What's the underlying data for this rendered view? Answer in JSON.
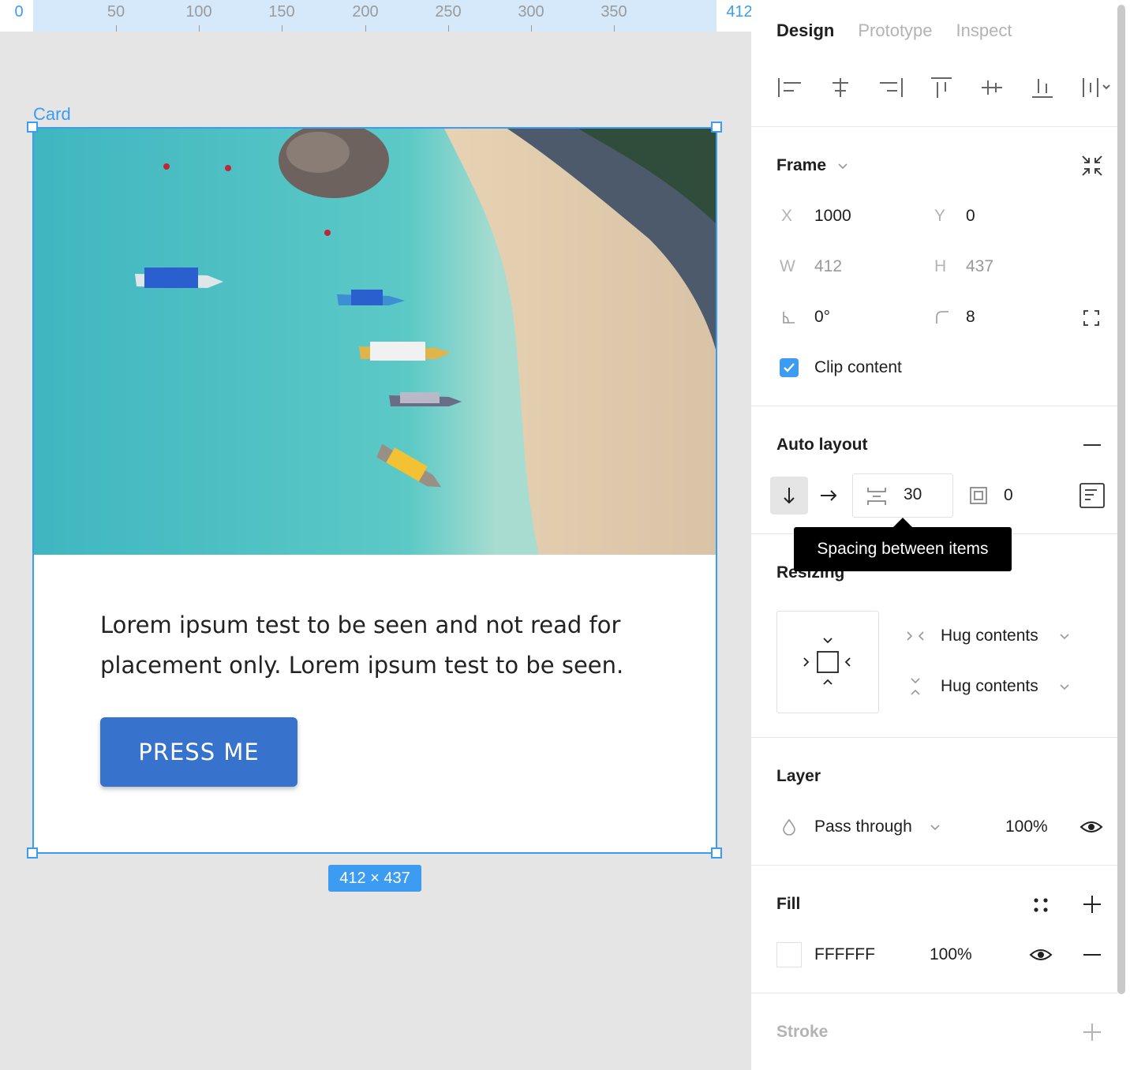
{
  "ruler": {
    "ticks": [
      "0",
      "50",
      "100",
      "150",
      "200",
      "250",
      "300",
      "350",
      "412"
    ]
  },
  "canvas": {
    "frame_label": "Card",
    "size_badge": "412 × 437",
    "card_text": "Lorem ipsum test to be seen and not read for placement only. Lorem ipsum test to be seen.",
    "button_label": "PRESS ME"
  },
  "panel": {
    "tabs": [
      "Design",
      "Prototype",
      "Inspect"
    ],
    "align_icons": [
      "align-left-icon",
      "align-horizontal-center-icon",
      "align-right-icon",
      "align-top-icon",
      "align-vertical-center-icon",
      "align-bottom-icon",
      "distribute-icon"
    ],
    "frame": {
      "title": "Frame",
      "x_label": "X",
      "x": "1000",
      "y_label": "Y",
      "y": "0",
      "w_label": "W",
      "w": "412",
      "h_label": "H",
      "h": "437",
      "rotation": "0°",
      "radius": "8",
      "clip_content": "Clip content",
      "clip_checked": true
    },
    "auto_layout": {
      "title": "Auto layout",
      "spacing": "30",
      "padding": "0",
      "tooltip": "Spacing between items"
    },
    "resizing": {
      "title": "Resizing",
      "horizontal": "Hug contents",
      "vertical": "Hug contents"
    },
    "layer": {
      "title": "Layer",
      "blend": "Pass through",
      "opacity": "100%"
    },
    "fill": {
      "title": "Fill",
      "hex": "FFFFFF",
      "opacity": "100%"
    },
    "stroke": {
      "title": "Stroke"
    }
  },
  "colors": {
    "selection": "#3b9cf2",
    "button": "#3772cc",
    "canvas_bg": "#e5e5e5"
  }
}
